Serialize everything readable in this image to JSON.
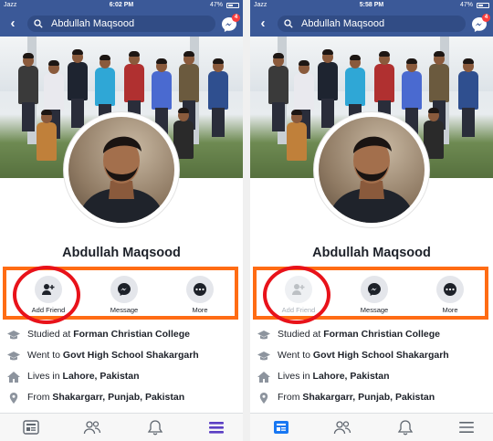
{
  "left": {
    "status": {
      "carrier": "Jazz",
      "time": "6:02 PM",
      "battery": "47%",
      "battery_level": 0.47
    },
    "search": {
      "value": "Abdullah Maqsood"
    },
    "messenger_badge": "4",
    "profile": {
      "name": "Abdullah Maqsood"
    },
    "actions": [
      {
        "label": "Add Friend",
        "icon": "add-friend-icon"
      },
      {
        "label": "Message",
        "icon": "messenger-icon"
      },
      {
        "label": "More",
        "icon": "more-icon"
      }
    ],
    "info": [
      {
        "prefix": "Studied at ",
        "value": "Forman Christian College",
        "icon": "graduation-cap-icon"
      },
      {
        "prefix": "Went to ",
        "value": "Govt High School Shakargarh",
        "icon": "graduation-cap-icon"
      },
      {
        "prefix": "Lives in ",
        "value": "Lahore, Pakistan",
        "icon": "home-icon"
      },
      {
        "prefix": "From ",
        "value": "Shakargarr, Punjab, Pakistan",
        "icon": "location-pin-icon"
      }
    ],
    "tabs": [
      "news-feed-icon",
      "friends-icon",
      "notifications-icon",
      "menu-icon"
    ],
    "active_tab": "menu-icon"
  },
  "right": {
    "status": {
      "carrier": "Jazz",
      "time": "5:58 PM",
      "battery": "47%",
      "battery_level": 0.47
    },
    "search": {
      "value": "Abdullah Maqsood"
    },
    "messenger_badge": "4",
    "profile": {
      "name": "Abdullah Maqsood"
    },
    "actions": [
      {
        "label": "Add Friend",
        "icon": "add-friend-icon",
        "disabled": true
      },
      {
        "label": "Message",
        "icon": "messenger-icon"
      },
      {
        "label": "More",
        "icon": "more-icon"
      }
    ],
    "info": [
      {
        "prefix": "Studied at ",
        "value": "Forman Christian College",
        "icon": "graduation-cap-icon"
      },
      {
        "prefix": "Went to ",
        "value": "Govt High School Shakargarh",
        "icon": "graduation-cap-icon"
      },
      {
        "prefix": "Lives in ",
        "value": "Lahore, Pakistan",
        "icon": "home-icon"
      },
      {
        "prefix": "From ",
        "value": "Shakargarr, Punjab, Pakistan",
        "icon": "location-pin-icon"
      }
    ],
    "tabs": [
      "news-feed-icon",
      "friends-icon",
      "notifications-icon",
      "menu-icon"
    ],
    "active_tab": "news-feed-icon"
  },
  "colors": {
    "facebook_blue": "#3b5998",
    "highlight_box": "#ff6c14",
    "highlight_ring": "#e8121a",
    "badge_red": "#fa3e3e"
  }
}
